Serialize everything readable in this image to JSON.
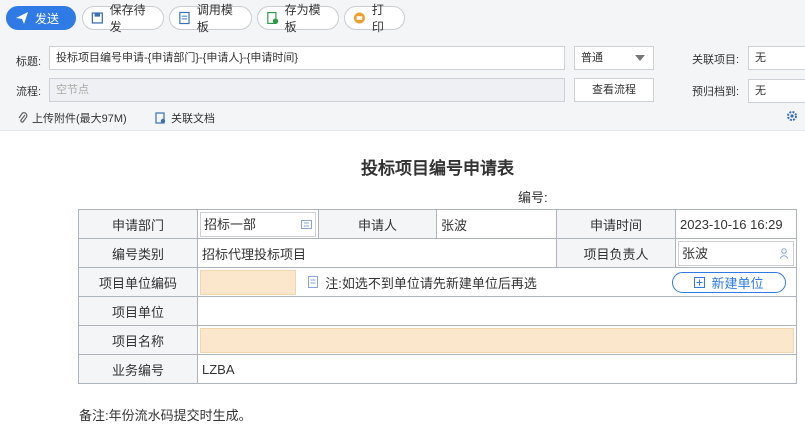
{
  "toolbar": {
    "send": "发送",
    "save_draft": "保存待发",
    "use_template": "调用模板",
    "save_template": "存为模板",
    "print": "打印"
  },
  "header": {
    "title_label": "标题:",
    "title_value": "投标项目编号申请-{申请部门}-{申请人}-{申请时间}",
    "priority": "普通",
    "related_label": "关联项目:",
    "related_value": "无",
    "flow_label": "流程:",
    "flow_placeholder": "空节点",
    "view_flow": "查看流程",
    "archive_label": "预归档到:",
    "archive_value": "无",
    "upload": "上传附件(最大97M)",
    "related_doc": "关联文档"
  },
  "form": {
    "title": "投标项目编号申请表",
    "number_label": "编号:",
    "dept_label": "申请部门",
    "dept_value": "招标一部",
    "applicant_label": "申请人",
    "applicant_value": "张波",
    "time_label": "申请时间",
    "time_value": "2023-10-16 16:29",
    "category_label": "编号类别",
    "category_value": "招标代理投标项目",
    "manager_label": "项目负责人",
    "manager_value": "张波",
    "unit_code_label": "项目单位编码",
    "unit_note": "注:如选不到单位请先新建单位后再选",
    "new_unit": "新建单位",
    "unit_label": "项目单位",
    "name_label": "项目名称",
    "biz_label": "业务编号",
    "biz_value": "LZBA"
  },
  "footnote": "备注:年份流水码提交时生成。",
  "colors": {
    "accent": "#2f7ae5",
    "highlight": "#fbe8cc"
  }
}
